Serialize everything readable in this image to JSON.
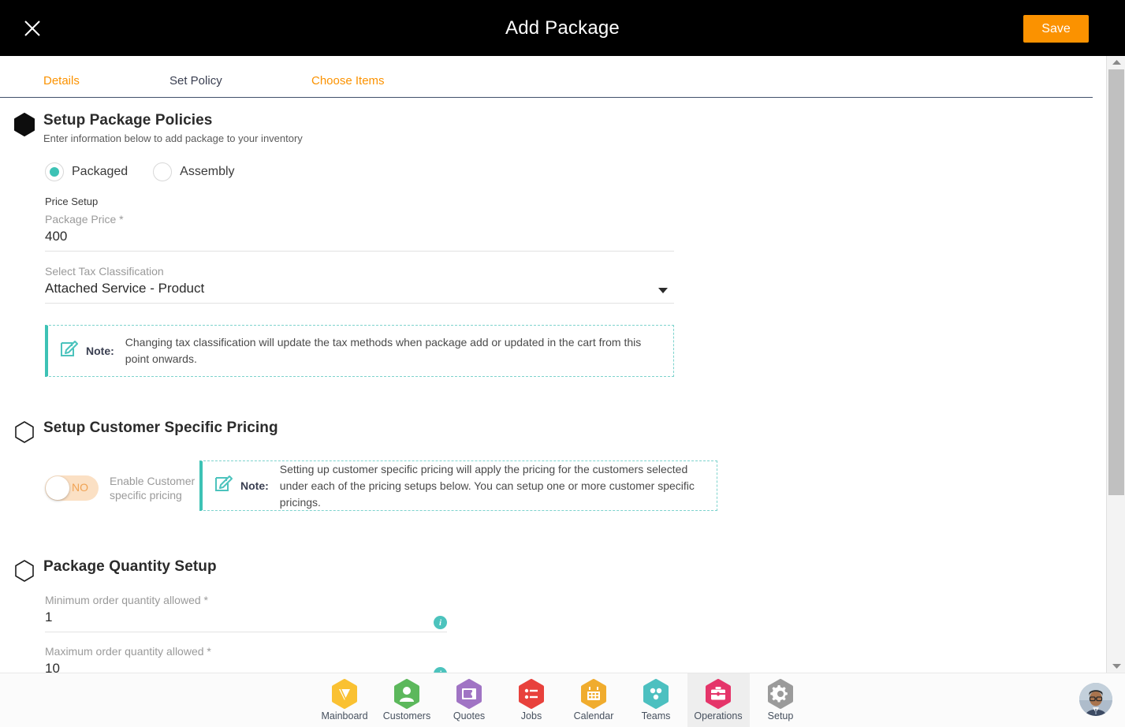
{
  "header": {
    "title": "Add Package",
    "close_icon": "close-icon",
    "save_label": "Save"
  },
  "tabs": [
    {
      "label": "Details",
      "active": false
    },
    {
      "label": "Set Policy",
      "active": true
    },
    {
      "label": "Choose Items",
      "active": false
    }
  ],
  "sections": {
    "package_policies": {
      "title": "Setup Package Policies",
      "subtitle": "Enter information below to add package to your inventory",
      "type_options": [
        {
          "label": "Packaged",
          "selected": true
        },
        {
          "label": "Assembly",
          "selected": false
        }
      ],
      "price_setup_caption": "Price Setup",
      "package_price": {
        "label": "Package Price *",
        "value": "400"
      },
      "tax_classification": {
        "label": "Select Tax Classification",
        "value": "Attached Service - Product",
        "caret_icon": "chevron-down-icon"
      },
      "note": {
        "icon": "note-edit-icon",
        "word": "Note:",
        "text": "Changing tax classification will update the tax methods when package add or updated in the cart from this point onwards."
      }
    },
    "customer_pricing": {
      "title": "Setup Customer Specific Pricing",
      "toggle": {
        "state": "NO",
        "label": "Enable Customer specific pricing"
      },
      "note": {
        "icon": "note-edit-icon",
        "word": "Note:",
        "text": "Setting up customer specific pricing will apply the pricing for the customers selected under each of the pricing setups below. You can setup one or more customer specific pricings."
      }
    },
    "quantity_setup": {
      "title": "Package Quantity Setup",
      "min_qty": {
        "label": "Minimum order quantity allowed *",
        "value": "1",
        "info_icon": "info-icon"
      },
      "max_qty": {
        "label": "Maximum order quantity allowed *",
        "value": "10",
        "info_icon": "info-icon"
      }
    }
  },
  "scrollbar": {
    "up_icon": "scroll-up-arrow-icon",
    "down_icon": "scroll-down-arrow-icon"
  },
  "bottom_nav": {
    "items": [
      {
        "label": "Mainboard",
        "icon": "mainboard-icon",
        "color": "#fac132",
        "active": false
      },
      {
        "label": "Customers",
        "icon": "person-icon",
        "color": "#5cb85c",
        "active": false
      },
      {
        "label": "Quotes",
        "icon": "quotes-icon",
        "color": "#a074c4",
        "active": false
      },
      {
        "label": "Jobs",
        "icon": "list-icon",
        "color": "#e8413c",
        "active": false
      },
      {
        "label": "Calendar",
        "icon": "calendar-icon",
        "color": "#f0ac2e",
        "active": false
      },
      {
        "label": "Teams",
        "icon": "teams-icon",
        "color": "#4cc0c0",
        "active": false
      },
      {
        "label": "Operations",
        "icon": "briefcase-icon",
        "color": "#e5356a",
        "active": true
      },
      {
        "label": "Setup",
        "icon": "gear-icon",
        "color": "#9b9b9b",
        "active": false
      }
    ],
    "avatar": "user-avatar"
  },
  "colors": {
    "accent_orange": "#fb9200",
    "teal": "#3dc2b5",
    "header_black": "#000000"
  }
}
